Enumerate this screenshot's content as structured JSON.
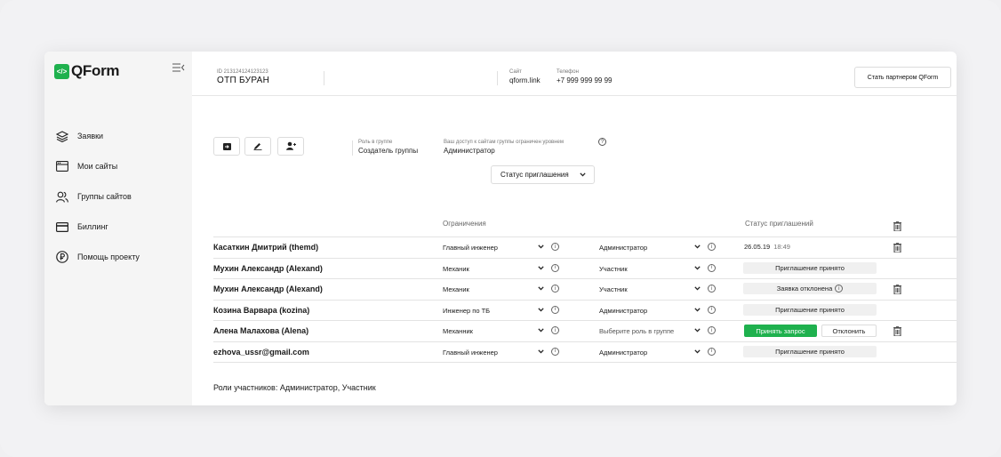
{
  "app": {
    "logo_text": "QForm",
    "logo_mark": "</>"
  },
  "sidebar": {
    "items": [
      {
        "label": "Заявки",
        "icon": "layers-icon"
      },
      {
        "label": "Мои сайты",
        "icon": "browser-window-icon"
      },
      {
        "label": "Группы сайтов",
        "icon": "users-icon"
      },
      {
        "label": "Биллинг",
        "icon": "credit-card-icon"
      },
      {
        "label": "Помощь проекту",
        "icon": "ruble-coin-icon"
      }
    ]
  },
  "header": {
    "id_label": "ID 213124124123123",
    "name": "ОТП БУРАН",
    "site_label": "Сайт",
    "site_value": "qform.link",
    "phone_label": "Телефон",
    "phone_value": "+7 999 999 99 99",
    "partner_button": "Стать партнером QForm"
  },
  "group": {
    "role_label": "Роль в группе",
    "role_value": "Создатель группы",
    "access_label": "Ваш доступ к сайтам группы ограничен уровнем",
    "access_value": "Администратор",
    "help_glyph": "?",
    "status_filter": "Статус приглашения"
  },
  "table": {
    "headers": {
      "restrictions": "Ограничения",
      "invite_status": "Статус приглашений"
    },
    "rows": [
      {
        "name": "Касаткин Дмитрий (themd)",
        "position": "Главный инженер",
        "role": "Администратор",
        "role_muted": false,
        "status_type": "date",
        "date": "26.05.19",
        "time": "18:49",
        "trash": true
      },
      {
        "name": "Мухин Александр (Alexand)",
        "position": "Механик",
        "role": "Участник",
        "role_muted": false,
        "status_type": "pill",
        "status": "Приглашение принято",
        "trash": false
      },
      {
        "name": "Мухин Александр (Alexand)",
        "position": "Механик",
        "role": "Участник",
        "role_muted": false,
        "status_type": "pill-info",
        "status": "Заявка отклонена",
        "trash": true
      },
      {
        "name": "Козина Варвара (kozina)",
        "position": "Инженер по ТБ",
        "role": "Администратор",
        "role_muted": false,
        "status_type": "pill",
        "status": "Приглашение принято",
        "trash": false
      },
      {
        "name": "Алена Малахова (Alena)",
        "position": "Механник",
        "role": "Выберите роль в группе",
        "role_muted": true,
        "status_type": "actions",
        "accept": "Принять запрос",
        "reject": "Отклонить",
        "trash": true
      },
      {
        "name": "ezhova_ussr@gmail.com",
        "position": "Главный инженер",
        "role": "Администратор",
        "role_muted": false,
        "status_type": "pill",
        "status": "Приглашение принято",
        "trash": false
      }
    ]
  },
  "footer": {
    "roles_note": "Роли участников: Администратор, Участник"
  },
  "colors": {
    "accent": "#1fb14e",
    "sidebar_bg": "#f5f5f5"
  }
}
